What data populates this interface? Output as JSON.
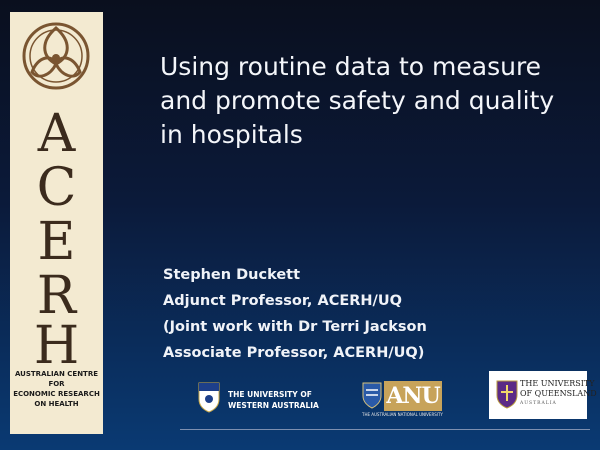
{
  "sidebar": {
    "letters": [
      "A",
      "C",
      "E",
      "R",
      "H"
    ],
    "org_lines": [
      "AUSTRALIAN CENTRE",
      "FOR",
      "ECONOMIC RESEARCH",
      "ON HEALTH"
    ],
    "bg_color": "#f3ead1",
    "logo_icon": "celtic-knot-icon"
  },
  "title": {
    "lines": [
      "Using routine data to measure",
      "and promote safety and quality",
      "in hospitals"
    ]
  },
  "author": {
    "lines": [
      "Stephen Duckett",
      "Adjunct Professor, ACERH/UQ",
      "(Joint work with Dr Terri Jackson",
      "Associate Professor, ACERH/UQ)"
    ]
  },
  "logos": {
    "uwa": {
      "lines": [
        "THE UNIVERSITY OF",
        "WESTERN AUSTRALIA"
      ],
      "icon": "uwa-crest-icon"
    },
    "anu": {
      "mark": "ANU",
      "sub": "THE AUSTRALIAN NATIONAL UNIVERSITY",
      "icon": "anu-crest-icon",
      "accent": "#c7a35a"
    },
    "uq": {
      "lines": [
        "THE UNIVERSITY",
        "OF QUEENSLAND"
      ],
      "sub": "AUSTRALIA",
      "icon": "uq-crest-icon"
    }
  }
}
